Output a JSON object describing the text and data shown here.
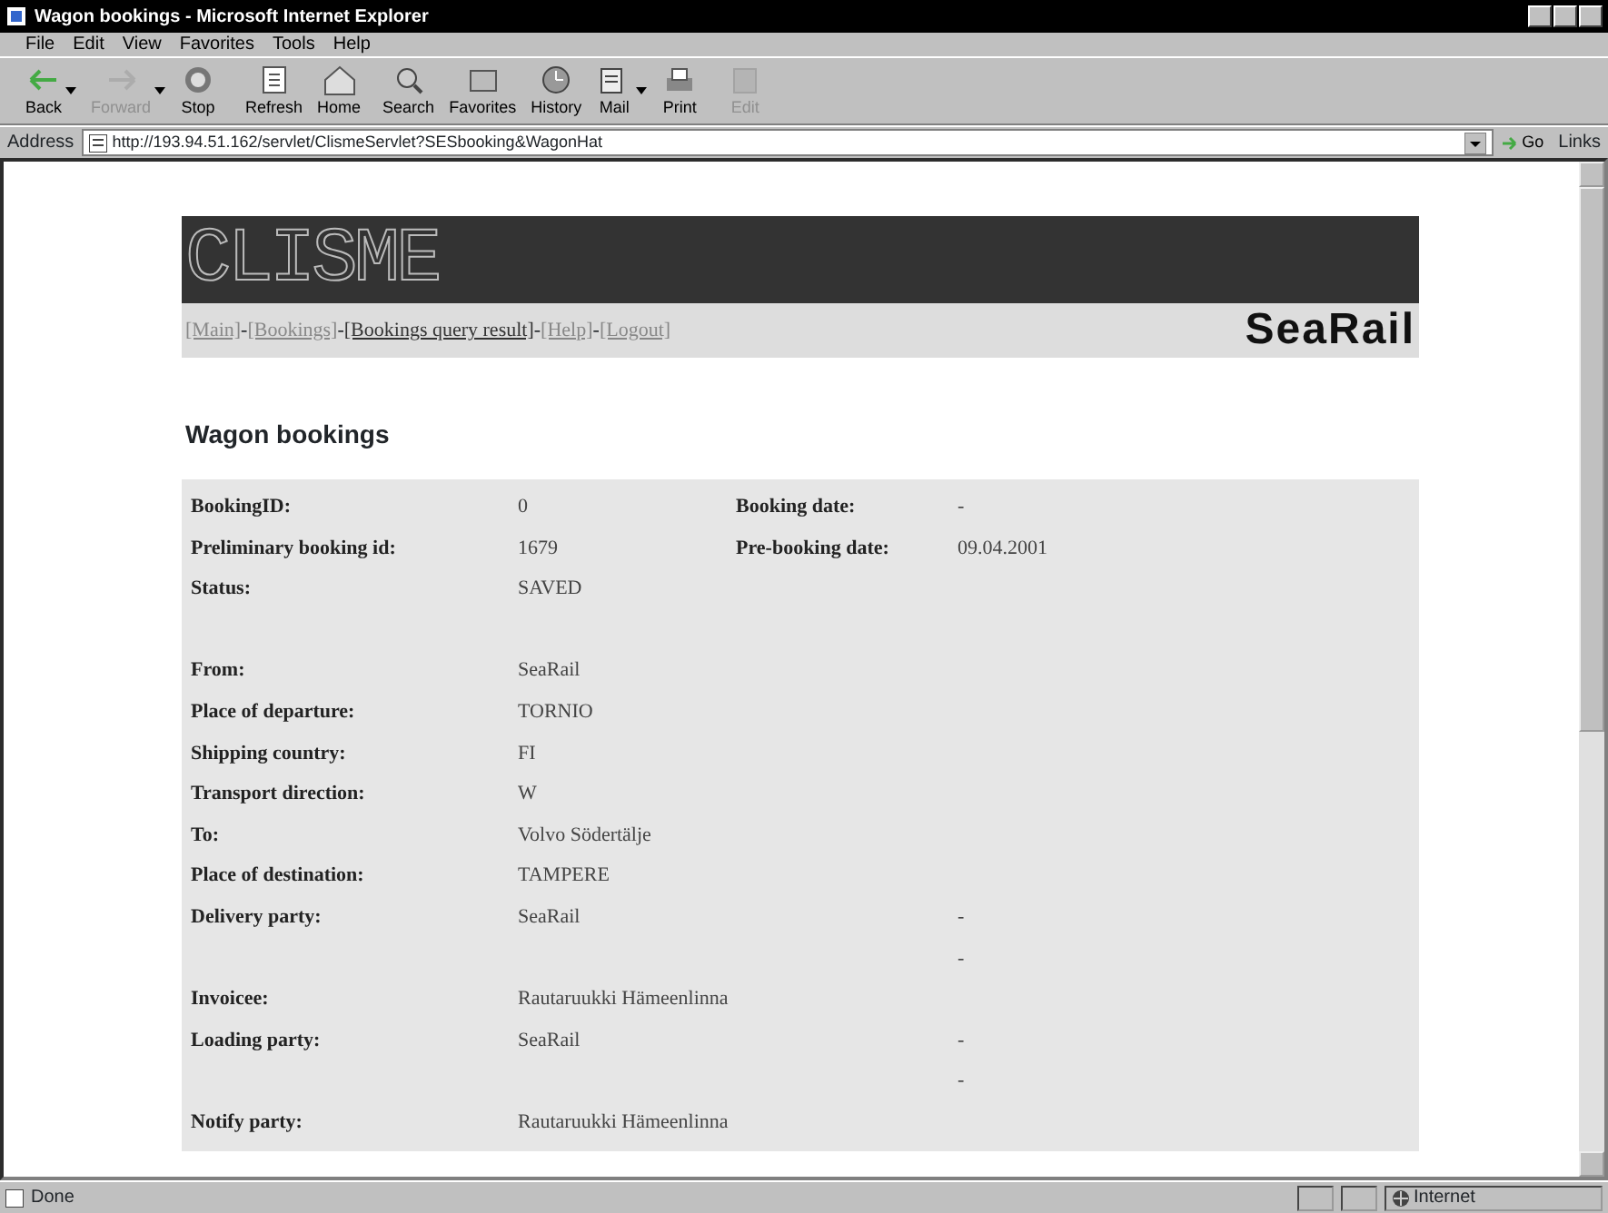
{
  "window": {
    "title": "Wagon bookings - Microsoft Internet Explorer"
  },
  "menu": [
    "File",
    "Edit",
    "View",
    "Favorites",
    "Tools",
    "Help"
  ],
  "toolbar": [
    {
      "label": "Back",
      "disabled": false,
      "dropdown": true
    },
    {
      "label": "Forward",
      "disabled": true,
      "dropdown": true
    },
    {
      "label": "Stop",
      "disabled": false,
      "dropdown": false
    },
    {
      "label": "Refresh",
      "disabled": false,
      "dropdown": false
    },
    {
      "label": "Home",
      "disabled": false,
      "dropdown": false
    },
    {
      "label": "Search",
      "disabled": false,
      "dropdown": false
    },
    {
      "label": "Favorites",
      "disabled": false,
      "dropdown": false
    },
    {
      "label": "History",
      "disabled": false,
      "dropdown": false
    },
    {
      "label": "Mail",
      "disabled": false,
      "dropdown": true
    },
    {
      "label": "Print",
      "disabled": false,
      "dropdown": false
    },
    {
      "label": "Edit",
      "disabled": true,
      "dropdown": false
    }
  ],
  "address_bar": {
    "label": "Address",
    "value": "http://193.94.51.162/servlet/ClismeServlet?SESbooking&WagonHat",
    "go": "Go",
    "links": "Links"
  },
  "page": {
    "logo": "CLISME",
    "brand": "SeaRail",
    "nav": [
      {
        "label": "[Main]",
        "current": false
      },
      {
        "label": "[Bookings]",
        "current": false
      },
      {
        "label": "[Bookings query result]",
        "current": true
      },
      {
        "label": "[Help]",
        "current": false
      },
      {
        "label": "[Logout]",
        "current": false
      }
    ],
    "nav_separator": "-",
    "heading": "Wagon bookings",
    "rows": [
      {
        "label": "BookingID:",
        "value": "0",
        "label2": "Booking date:",
        "value2": "-"
      },
      {
        "label": "Preliminary booking id:",
        "value": "1679",
        "label2": "Pre-booking date:",
        "value2": "09.04.2001"
      },
      {
        "label": "Status:",
        "value": "SAVED"
      },
      {},
      {
        "label": "From:",
        "value": "SeaRail"
      },
      {
        "label": "Place of departure:",
        "value": "TORNIO"
      },
      {
        "label": "Shipping country:",
        "value": "FI"
      },
      {
        "label": "Transport direction:",
        "value": "W"
      },
      {
        "label": "To:",
        "value": "Volvo Södertälje"
      },
      {
        "label": "Place of destination:",
        "value": "TAMPERE"
      },
      {
        "label": "Delivery party:",
        "value": "SeaRail",
        "value2": "-"
      },
      {
        "value2": "-"
      },
      {
        "label": "Invoicee:",
        "value": "Rautaruukki Hämeenlinna"
      },
      {
        "label": "Loading party:",
        "value": "SeaRail",
        "value2": "-"
      },
      {
        "value2": "-"
      },
      {
        "label": "Notify party:",
        "value": "Rautaruukki Hämeenlinna"
      }
    ]
  },
  "status_bar": {
    "text": "Done",
    "zone": "Internet"
  }
}
